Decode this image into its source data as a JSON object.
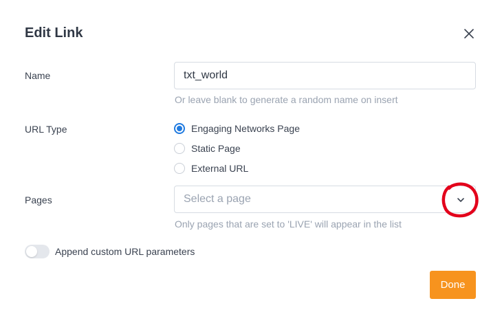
{
  "dialog": {
    "title": "Edit Link",
    "close_icon": "close-icon"
  },
  "name_field": {
    "label": "Name",
    "value": "txt_world",
    "help": "Or leave blank to generate a random name on insert"
  },
  "url_type": {
    "label": "URL Type",
    "options": [
      {
        "label": "Engaging Networks Page",
        "checked": true
      },
      {
        "label": "Static Page",
        "checked": false
      },
      {
        "label": "External URL",
        "checked": false
      }
    ]
  },
  "pages": {
    "label": "Pages",
    "placeholder": "Select a page",
    "help": "Only pages that are set to 'LIVE' will appear in the list",
    "icon": "chevron-down-icon"
  },
  "append_params": {
    "label": "Append custom URL parameters",
    "enabled": false
  },
  "footer": {
    "done_label": "Done"
  },
  "colors": {
    "accent": "#1f7ae0",
    "done_button": "#f7931e",
    "annotation": "#e3001b"
  }
}
